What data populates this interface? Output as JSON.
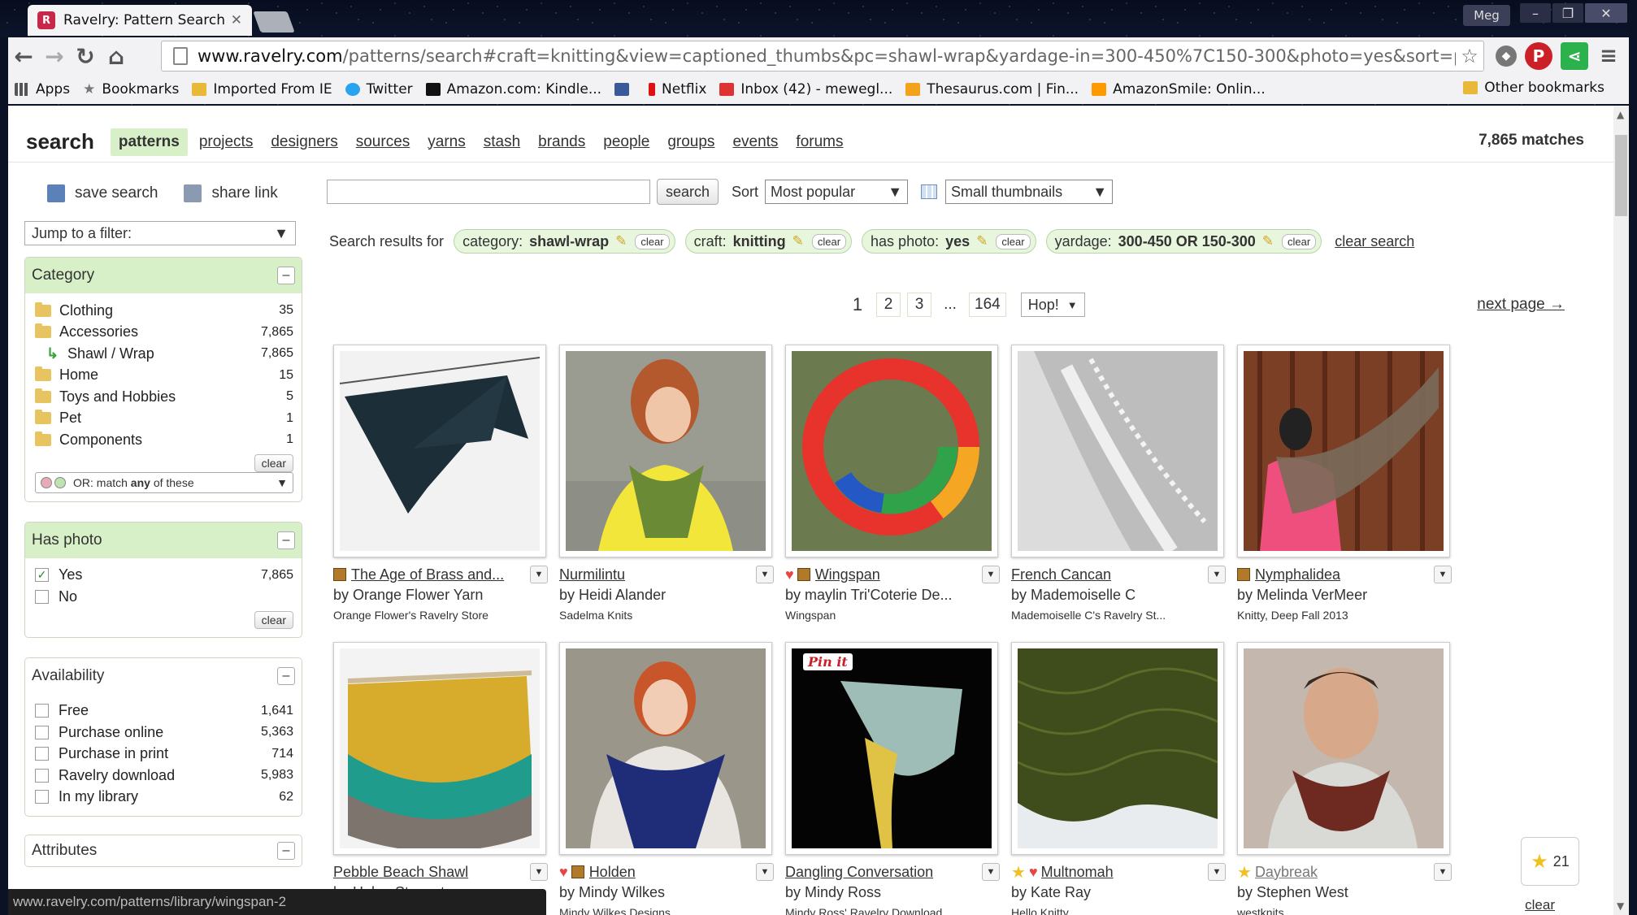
{
  "browser": {
    "tab_title": "Ravelry: Pattern Search",
    "url_host": "www.ravelry.com",
    "url_path": "/patterns/search#craft=knitting&view=captioned_thumbs&pc=shawl-wrap&yardage-in=300-450%7C150-300&photo=yes&sort=pop",
    "user": "Meg",
    "bookmarks": [
      "Apps",
      "Bookmarks",
      "Imported From IE",
      "Twitter",
      "Amazon.com: Kindle...",
      "",
      "Netflix",
      "Inbox (42) - mewegl...",
      "Thesaurus.com | Fin...",
      "AmazonSmile: Onlin..."
    ],
    "other_bookmarks": "Other bookmarks",
    "status_url": "www.ravelry.com/patterns/library/wingspan-2"
  },
  "topnav": {
    "title": "search",
    "links": [
      "patterns",
      "projects",
      "designers",
      "sources",
      "yarns",
      "stash",
      "brands",
      "people",
      "groups",
      "events",
      "forums"
    ],
    "matches": "7,865 matches"
  },
  "sidebar": {
    "save_search": "save search",
    "share_link": "share link",
    "jump_filter": "Jump to a filter:",
    "category": {
      "title": "Category",
      "items": [
        {
          "label": "Clothing",
          "count": "35"
        },
        {
          "label": "Accessories",
          "count": "7,865"
        },
        {
          "label": "Shawl / Wrap",
          "count": "7,865"
        },
        {
          "label": "Home",
          "count": "15"
        },
        {
          "label": "Toys and Hobbies",
          "count": "5"
        },
        {
          "label": "Pet",
          "count": "1"
        },
        {
          "label": "Components",
          "count": "1"
        }
      ],
      "clear": "clear",
      "match_pre": "OR: match",
      "match_any": "any",
      "match_post": "of these"
    },
    "has_photo": {
      "title": "Has photo",
      "items": [
        {
          "label": "Yes",
          "count": "7,865",
          "checked": true
        },
        {
          "label": "No",
          "count": "",
          "checked": false
        }
      ],
      "clear": "clear"
    },
    "availability": {
      "title": "Availability",
      "items": [
        {
          "label": "Free",
          "count": "1,641"
        },
        {
          "label": "Purchase online",
          "count": "5,363"
        },
        {
          "label": "Purchase in print",
          "count": "714"
        },
        {
          "label": "Ravelry download",
          "count": "5,983"
        },
        {
          "label": "In my library",
          "count": "62"
        }
      ]
    },
    "attributes_title": "Attributes"
  },
  "search": {
    "button": "search",
    "sort_label": "Sort",
    "sort_value": "Most popular",
    "view_value": "Small thumbnails",
    "results_for": "Search results for",
    "chips": [
      {
        "key": "category:",
        "value": "shawl-wrap",
        "clear": "clear"
      },
      {
        "key": "craft:",
        "value": "knitting",
        "clear": "clear"
      },
      {
        "key": "has photo:",
        "value": "yes",
        "clear": "clear"
      },
      {
        "key": "yardage:",
        "value": "300-450 OR 150-300",
        "clear": "clear"
      }
    ],
    "clear_search": "clear search"
  },
  "pager": {
    "current": "1",
    "pages": [
      "2",
      "3"
    ],
    "dots": "...",
    "last": "164",
    "hop": "Hop!",
    "next": "next page →"
  },
  "patterns": [
    {
      "title": "The Age of Brass and...",
      "by": "by Orange Flower Yarn",
      "source": "Orange Flower's Ravelry Store",
      "heart": false,
      "book": true,
      "star": false
    },
    {
      "title": "Nurmilintu",
      "by": "by Heidi Alander",
      "source": "Sadelma Knits",
      "heart": false,
      "book": false,
      "star": false
    },
    {
      "title": "Wingspan",
      "by": "by maylin Tri'Coterie De...",
      "source": "Wingspan",
      "heart": true,
      "book": true,
      "star": false
    },
    {
      "title": "French Cancan",
      "by": "by Mademoiselle C",
      "source": "Mademoiselle C's Ravelry St...",
      "heart": false,
      "book": false,
      "star": false
    },
    {
      "title": "Nymphalidea",
      "by": "by Melinda VerMeer",
      "source": "Knitty, Deep Fall 2013",
      "heart": false,
      "book": true,
      "star": false
    },
    {
      "title": "Pebble Beach Shawl",
      "by": "by Helen Stewart",
      "source": "",
      "heart": false,
      "book": false,
      "star": false
    },
    {
      "title": "Holden",
      "by": "by Mindy Wilkes",
      "source": "Mindy Wilkes Designs",
      "heart": true,
      "book": true,
      "star": false
    },
    {
      "title": "Dangling Conversation",
      "by": "by Mindy Ross",
      "source": "Mindy Ross' Ravelry Download",
      "heart": false,
      "book": false,
      "star": false
    },
    {
      "title": "Multnomah",
      "by": "by Kate Ray",
      "source": "Hello Knitty",
      "heart": true,
      "book": false,
      "star": true
    },
    {
      "title": "Daybreak",
      "by": "by Stephen West",
      "source": "westknits",
      "heart": false,
      "book": false,
      "star": true
    }
  ],
  "pin_it": "Pin it",
  "favorites": {
    "count": "21",
    "clear": "clear"
  }
}
